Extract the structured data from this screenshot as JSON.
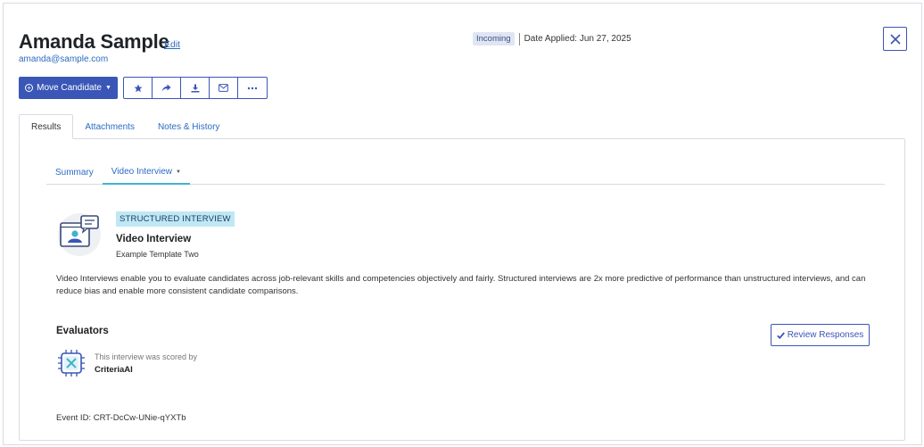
{
  "candidate": {
    "name": "Amanda Sample",
    "edit_label": "Edit",
    "email": "amanda@sample.com",
    "status": "Incoming",
    "date_applied": "Date Applied: Jun 27, 2025"
  },
  "actions": {
    "move_label": "Move Candidate",
    "toolbar_icons": [
      "star-icon",
      "share-icon",
      "download-icon",
      "envelope-icon",
      "more-icon"
    ]
  },
  "tabs": [
    {
      "label": "Results",
      "active": true
    },
    {
      "label": "Attachments",
      "active": false
    },
    {
      "label": "Notes & History",
      "active": false
    }
  ],
  "subtabs": [
    {
      "label": "Summary",
      "active": false
    },
    {
      "label": "Video Interview",
      "active": true
    }
  ],
  "interview": {
    "badge": "STRUCTURED INTERVIEW",
    "title": "Video Interview",
    "template": "Example Template Two",
    "description": "Video Interviews enable you to evaluate candidates across job-relevant skills and competencies objectively and fairly. Structured interviews are 2x more predictive of performance than unstructured interviews, and can reduce bias and enable more consistent candidate comparisons."
  },
  "evaluators": {
    "title": "Evaluators",
    "review_label": "Review Responses",
    "scored_text": "This interview was scored by",
    "scorer": "CriteriaAI"
  },
  "event_id": "Event ID: CRT-DcCw-UNie-qYXTb",
  "colors": {
    "primary": "#3a56b7",
    "link": "#2a6bc2",
    "accent": "#3fb3cf",
    "badge_bg": "#bfe7f4"
  }
}
